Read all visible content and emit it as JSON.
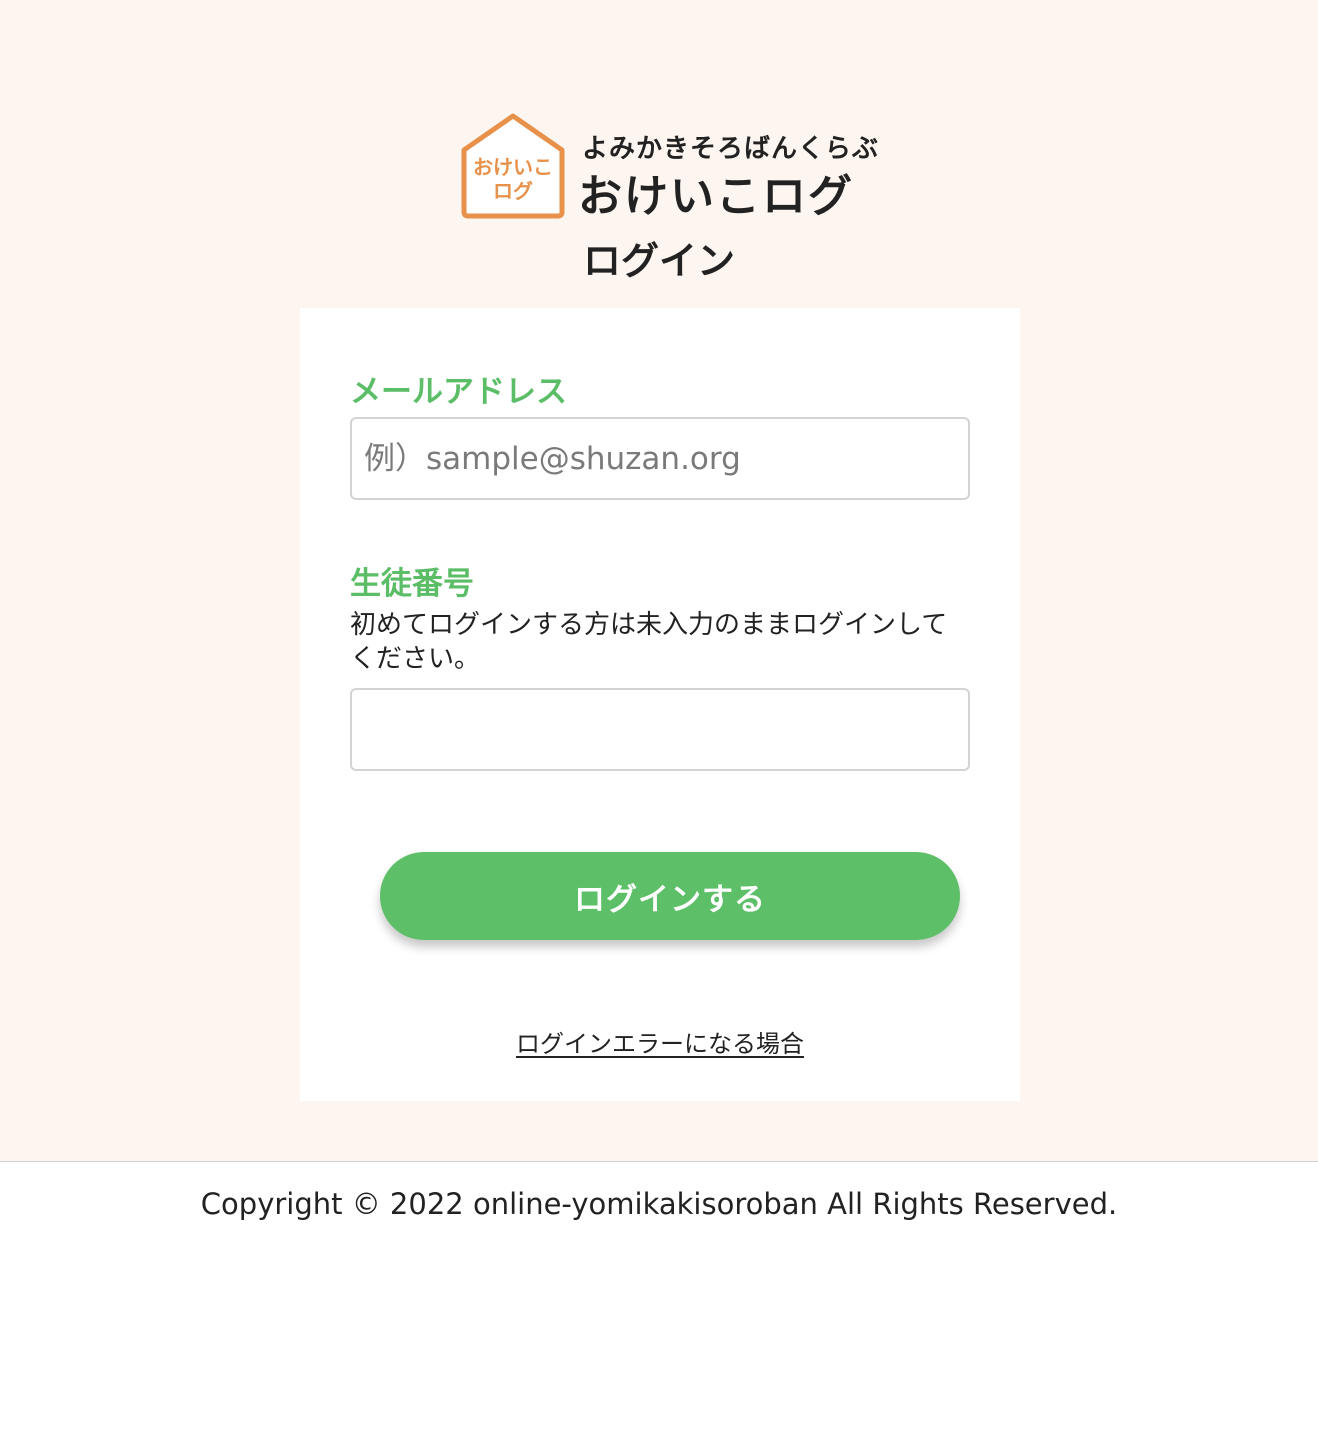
{
  "brand": {
    "icon_text_line1": "おけいこ",
    "icon_text_line2": "ログ",
    "subtitle": "よみかきそろばんくらぶ",
    "title": "おけいこログ",
    "accent_color": "#e8914a"
  },
  "page": {
    "heading": "ログイン"
  },
  "form": {
    "email_label": "メールアドレス",
    "email_placeholder": "例）sample@shuzan.org",
    "email_value": "",
    "student_label": "生徒番号",
    "student_hint": "初めてログインする方は未入力のままログインしてください。",
    "student_value": "",
    "submit_label": "ログインする",
    "error_link": "ログインエラーになる場合",
    "label_color": "#5cbd67",
    "button_color": "#5ebf69"
  },
  "footer": {
    "copyright": "Copyright © 2022 online-yomikakisoroban All Rights Reserved."
  }
}
